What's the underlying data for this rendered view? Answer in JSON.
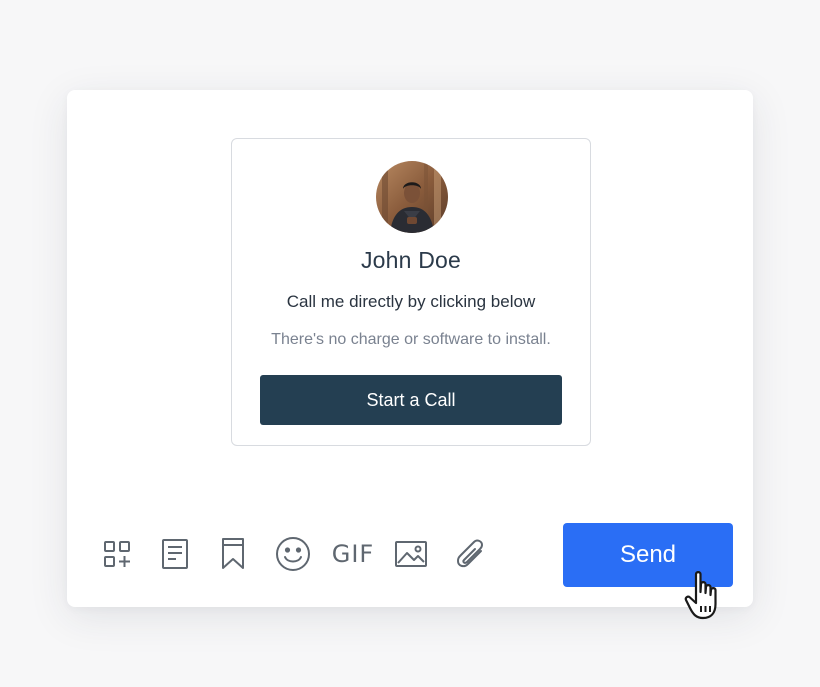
{
  "card": {
    "name": "John Doe",
    "tagline": "Call me directly by clicking below",
    "note": "There's no charge or software to install.",
    "call_button_label": "Start a Call"
  },
  "toolbar": {
    "icons": [
      "apps-add-icon",
      "document-icon",
      "bookmark-icon",
      "emoji-icon",
      "gif-icon",
      "image-icon",
      "attachment-icon"
    ],
    "gif_label": "GIF"
  },
  "send_button_label": "Send",
  "colors": {
    "call_button": "#243f52",
    "send_button": "#2a6ef5",
    "icon": "#5f6770",
    "text": "#2b3a4a"
  }
}
